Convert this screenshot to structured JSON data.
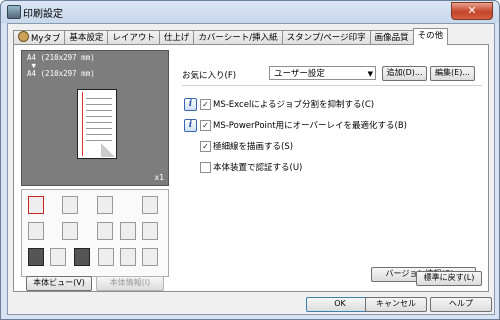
{
  "window": {
    "title": "印刷設定",
    "close_label": "✕"
  },
  "tabs": [
    {
      "label": "Myタブ",
      "active": false
    },
    {
      "label": "基本設定",
      "active": false
    },
    {
      "label": "レイアウト",
      "active": false
    },
    {
      "label": "仕上げ",
      "active": false
    },
    {
      "label": "カバーシート/挿入紙",
      "active": false
    },
    {
      "label": "スタンプ/ページ印字",
      "active": false
    },
    {
      "label": "画像品質",
      "active": false
    },
    {
      "label": "その他",
      "active": true
    }
  ],
  "preview": {
    "paper_text": "A4 (210x297 mm)\n ▼\nA4 (210x297 mm)",
    "copies": "x1",
    "view_button": "本体ビュー(V)",
    "info_button": "本体情報(I)"
  },
  "favorites": {
    "label": "お気に入り(F)",
    "value": "ユーザー設定",
    "add_button": "追加(D)...",
    "edit_button": "編集(E)..."
  },
  "options": [
    {
      "label": "MS-Excelによるジョブ分割を抑制する(C)",
      "checked": true,
      "info": true
    },
    {
      "label": "MS-PowerPoint用にオーバーレイを最適化する(B)",
      "checked": true,
      "info": true
    },
    {
      "label": "極細線を描画する(S)",
      "checked": true,
      "info": false
    },
    {
      "label": "本体装置で認証する(U)",
      "checked": false,
      "info": false
    }
  ],
  "version_button": "バージョン情報(O)...",
  "default_button": "標準に戻す(L)",
  "dialog": {
    "ok": "OK",
    "cancel": "キャンセル",
    "help": "ヘルプ"
  }
}
